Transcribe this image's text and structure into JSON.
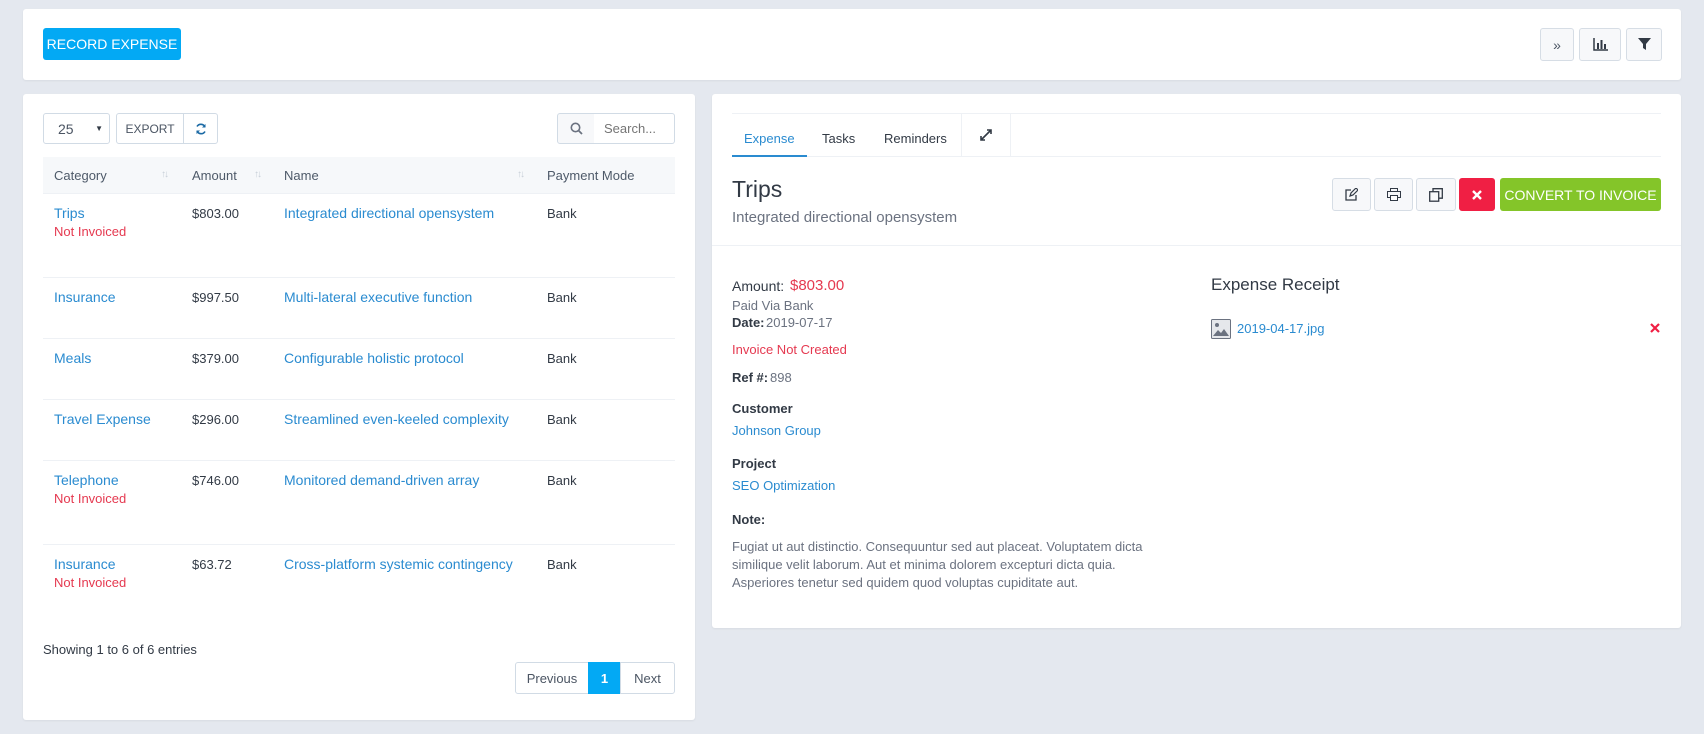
{
  "toolbar": {
    "record_expense": "RECORD EXPENSE"
  },
  "table_controls": {
    "page_size": "25",
    "export": "EXPORT",
    "search_placeholder": "Search..."
  },
  "table": {
    "headers": [
      "Category",
      "Amount",
      "Name",
      "Payment Mode"
    ],
    "rows": [
      {
        "category": "Trips",
        "status": "Not Invoiced",
        "amount": "$803.00",
        "name": "Integrated directional opensystem",
        "mode": "Bank"
      },
      {
        "category": "Insurance",
        "status": "",
        "amount": "$997.50",
        "name": "Multi-lateral executive function",
        "mode": "Bank"
      },
      {
        "category": "Meals",
        "status": "",
        "amount": "$379.00",
        "name": "Configurable holistic protocol",
        "mode": "Bank"
      },
      {
        "category": "Travel Expense",
        "status": "",
        "amount": "$296.00",
        "name": "Streamlined even-keeled complexity",
        "mode": "Bank"
      },
      {
        "category": "Telephone",
        "status": "Not Invoiced",
        "amount": "$746.00",
        "name": "Monitored demand-driven array",
        "mode": "Bank"
      },
      {
        "category": "Insurance",
        "status": "Not Invoiced",
        "amount": "$63.72",
        "name": "Cross-platform systemic contingency",
        "mode": "Bank"
      }
    ],
    "info": "Showing 1 to 6 of 6 entries",
    "pagination": {
      "previous": "Previous",
      "current": "1",
      "next": "Next"
    }
  },
  "detail": {
    "tabs": [
      "Expense",
      "Tasks",
      "Reminders"
    ],
    "title": "Trips",
    "subtitle": "Integrated directional opensystem",
    "convert_button": "CONVERT TO INVOICE",
    "amount_label": "Amount:",
    "amount_value": "$803.00",
    "paid_via": "Paid Via Bank",
    "date_label": "Date:",
    "date_value": "2019-07-17",
    "invoice_status": "Invoice Not Created",
    "ref_label": "Ref #:",
    "ref_value": "898",
    "customer_label": "Customer",
    "customer_value": "Johnson Group",
    "project_label": "Project",
    "project_value": "SEO Optimization",
    "note_label": "Note:",
    "note_lines": [
      "Fugiat ut aut distinctio. Consequuntur sed aut placeat. Voluptatem dicta",
      "similique velit laborum. Aut et minima dolorem excepturi dicta quia.",
      "Asperiores tenetur sed quidem quod voluptas cupiditate aut."
    ],
    "receipt_title": "Expense Receipt",
    "receipt_file": "2019-04-17.jpg"
  },
  "colors": {
    "primary": "#03a9f4",
    "success": "#84c529",
    "danger": "#f01f44",
    "link": "#2a8bd0"
  }
}
